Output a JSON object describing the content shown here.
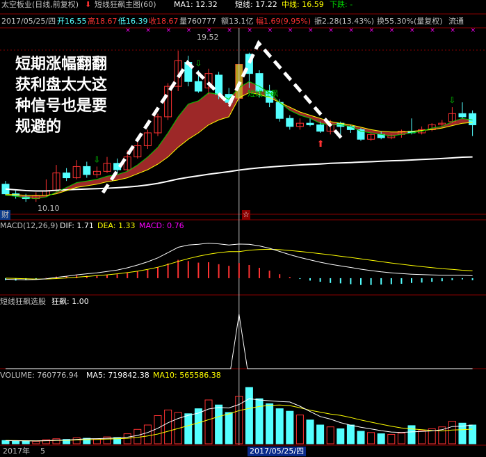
{
  "header": {
    "stock": "太空板业(日线,前复权)",
    "indicator": "短线狂飙主图(60)",
    "ma1": "MA1: 12.32",
    "short": "短线: 17.22",
    "mid": "中线: 16.59",
    "down": "下跌: -",
    "date": "2017/05/25/四",
    "open": "开16.55",
    "high": "高18.67",
    "low": "低16.39",
    "close": "收18.67",
    "volume": "量760777",
    "amount": "额13.1亿",
    "change": "幅1.69(9.95%)",
    "amplitude": "振2.28(13.43%)",
    "turnover": "换55.30%(量复权)",
    "float": "流通",
    "cursor_marker": "☆",
    "left_tag": "财"
  },
  "annotations": {
    "high_label": "19.52",
    "low_label": "10.10",
    "series_label": "短线狂飙",
    "note_lines": [
      "短期涨幅翻翻",
      "获利盘太大这",
      "种信号也是要",
      "规避的"
    ]
  },
  "macd_panel": {
    "title": "MACD(12,26,9)",
    "dif": "DIF: 1.71",
    "dea": "DEA: 1.33",
    "macd": "MACD: 0.76"
  },
  "signal_panel": {
    "title": "短线狂飙选股",
    "value": "狂飙: 1.00"
  },
  "volume_panel": {
    "title": "VOLUME: 760776.94",
    "ma5": "MA5: 719842.38",
    "ma10": "MA10: 565586.38"
  },
  "footer": {
    "year": "2017年",
    "month": "5",
    "date_box": "2017/05/25/四"
  },
  "colors": {
    "up": "#ff3232",
    "down": "#54ffff",
    "ma_white": "#ffffff",
    "ma_yellow": "#ffff00",
    "green_line": "#00cc00",
    "fill_red": "#a52a2a",
    "magenta": "#ff00ff"
  },
  "chart_data": {
    "type": "candlestick",
    "candles": [
      {
        "o": 11.2,
        "c": 10.6,
        "h": 11.4,
        "l": 10.5
      },
      {
        "o": 10.6,
        "c": 10.5,
        "h": 10.8,
        "l": 10.3
      },
      {
        "o": 10.4,
        "c": 10.3,
        "h": 10.6,
        "l": 10.1
      },
      {
        "o": 10.3,
        "c": 10.5,
        "h": 10.7,
        "l": 10.1
      },
      {
        "o": 10.5,
        "c": 10.8,
        "h": 11.5,
        "l": 10.4
      },
      {
        "o": 10.8,
        "c": 11.9,
        "h": 12.4,
        "l": 10.7
      },
      {
        "o": 11.9,
        "c": 11.6,
        "h": 12.2,
        "l": 11.4
      },
      {
        "o": 11.6,
        "c": 12.3,
        "h": 12.7,
        "l": 11.5
      },
      {
        "o": 12.3,
        "c": 11.8,
        "h": 12.6,
        "l": 11.6
      },
      {
        "o": 11.8,
        "c": 12.0,
        "h": 12.3,
        "l": 11.6
      },
      {
        "o": 12.0,
        "c": 12.5,
        "h": 12.9,
        "l": 11.9
      },
      {
        "o": 12.5,
        "c": 12.1,
        "h": 12.8,
        "l": 11.9
      },
      {
        "o": 12.1,
        "c": 12.9,
        "h": 13.3,
        "l": 12.0
      },
      {
        "o": 12.9,
        "c": 13.6,
        "h": 14.0,
        "l": 12.8
      },
      {
        "o": 13.6,
        "c": 14.4,
        "h": 14.6,
        "l": 13.4
      },
      {
        "o": 14.4,
        "c": 15.4,
        "h": 15.6,
        "l": 14.2
      },
      {
        "o": 15.4,
        "c": 17.3,
        "h": 17.5,
        "l": 15.2
      },
      {
        "o": 17.3,
        "c": 18.9,
        "h": 19.52,
        "l": 17.0
      },
      {
        "o": 18.8,
        "c": 17.6,
        "h": 19.2,
        "l": 17.3
      },
      {
        "o": 17.6,
        "c": 17.0,
        "h": 18.3,
        "l": 16.9
      },
      {
        "o": 17.2,
        "c": 18.1,
        "h": 18.4,
        "l": 16.8
      },
      {
        "o": 18.0,
        "c": 16.8,
        "h": 18.2,
        "l": 16.5
      },
      {
        "o": 16.8,
        "c": 16.3,
        "h": 17.2,
        "l": 16.1
      },
      {
        "o": 16.55,
        "c": 18.67,
        "h": 18.67,
        "l": 16.39
      },
      {
        "o": 19.3,
        "c": 18.1,
        "h": 19.4,
        "l": 17.2
      },
      {
        "o": 18.1,
        "c": 17.0,
        "h": 18.3,
        "l": 16.6
      },
      {
        "o": 17.0,
        "c": 16.3,
        "h": 17.4,
        "l": 16.0
      },
      {
        "o": 16.3,
        "c": 15.3,
        "h": 16.5,
        "l": 15.1
      },
      {
        "o": 15.3,
        "c": 14.8,
        "h": 15.5,
        "l": 14.6
      },
      {
        "o": 14.8,
        "c": 15.0,
        "h": 15.3,
        "l": 14.6
      },
      {
        "o": 15.0,
        "c": 14.9,
        "h": 15.3,
        "l": 14.8
      },
      {
        "o": 14.9,
        "c": 14.5,
        "h": 15.1,
        "l": 14.4
      },
      {
        "o": 14.5,
        "c": 14.9,
        "h": 15.2,
        "l": 14.3
      },
      {
        "o": 15.0,
        "c": 14.8,
        "h": 15.1,
        "l": 14.3
      },
      {
        "o": 14.8,
        "c": 14.6,
        "h": 14.9,
        "l": 14.4
      },
      {
        "o": 14.6,
        "c": 14.0,
        "h": 14.7,
        "l": 13.9
      },
      {
        "o": 14.0,
        "c": 14.3,
        "h": 14.4,
        "l": 13.9
      },
      {
        "o": 14.3,
        "c": 14.1,
        "h": 14.5,
        "l": 14.0
      },
      {
        "o": 14.1,
        "c": 14.2,
        "h": 14.3,
        "l": 14.0
      },
      {
        "o": 14.3,
        "c": 14.5,
        "h": 14.6,
        "l": 14.1
      },
      {
        "o": 14.5,
        "c": 14.4,
        "h": 15.3,
        "l": 14.3
      },
      {
        "o": 14.4,
        "c": 14.6,
        "h": 14.8,
        "l": 14.3
      },
      {
        "o": 14.6,
        "c": 14.9,
        "h": 15.0,
        "l": 14.5
      },
      {
        "o": 14.9,
        "c": 15.0,
        "h": 15.2,
        "l": 14.7
      },
      {
        "o": 15.1,
        "c": 15.6,
        "h": 16.0,
        "l": 15.0
      },
      {
        "o": 15.6,
        "c": 15.4,
        "h": 16.3,
        "l": 15.3
      },
      {
        "o": 15.6,
        "c": 14.9,
        "h": 15.8,
        "l": 14.2
      }
    ],
    "ma_long": [
      10.9,
      10.85,
      10.8,
      10.78,
      10.78,
      10.82,
      10.85,
      10.88,
      10.9,
      10.92,
      10.95,
      10.98,
      11.02,
      11.08,
      11.15,
      11.25,
      11.38,
      11.52,
      11.63,
      11.72,
      11.82,
      11.9,
      11.98,
      12.08,
      12.16,
      12.22,
      12.27,
      12.32,
      12.36,
      12.4,
      12.43,
      12.46,
      12.5,
      12.52,
      12.55,
      12.58,
      12.6,
      12.63,
      12.66,
      12.68,
      12.71,
      12.74,
      12.77,
      12.8,
      12.84,
      12.88,
      12.9
    ],
    "short_line": [
      10.5,
      10.45,
      10.35,
      10.3,
      10.4,
      10.7,
      11.0,
      11.3,
      11.4,
      11.5,
      11.7,
      11.8,
      12.0,
      12.4,
      12.9,
      13.5,
      14.4,
      15.4,
      16.2,
      16.4,
      16.9,
      16.8,
      16.5,
      17.22,
      17.6,
      17.3,
      16.9,
      16.3,
      15.8,
      15.5,
      15.3,
      15.0,
      14.9,
      14.9,
      14.8,
      14.5,
      14.4,
      14.3,
      14.2,
      14.3,
      14.4,
      14.5,
      14.7,
      14.8,
      15.1,
      15.3,
      15.2
    ],
    "mid_line": [
      10.55,
      10.55,
      10.5,
      10.48,
      10.5,
      10.6,
      10.8,
      11.0,
      11.1,
      11.2,
      11.35,
      11.45,
      11.6,
      11.85,
      12.1,
      12.45,
      12.9,
      13.5,
      14.0,
      14.4,
      14.9,
      15.2,
      15.4,
      16.59,
      16.9,
      16.8,
      16.6,
      16.3,
      16.0,
      15.7,
      15.5,
      15.3,
      15.1,
      15.0,
      14.9,
      14.75,
      14.6,
      14.5,
      14.45,
      14.45,
      14.5,
      14.55,
      14.6,
      14.7,
      14.85,
      15.0,
      15.05
    ],
    "price_range": [
      9.5,
      20.6
    ],
    "macd": {
      "hist": [
        -0.1,
        -0.12,
        -0.1,
        -0.05,
        0.02,
        0.08,
        0.1,
        0.14,
        0.12,
        0.14,
        0.18,
        0.2,
        0.26,
        0.34,
        0.42,
        0.56,
        0.74,
        0.92,
        0.86,
        0.78,
        0.8,
        0.7,
        0.62,
        0.76,
        0.66,
        0.52,
        0.38,
        0.2,
        0.06,
        -0.04,
        -0.12,
        -0.18,
        -0.24,
        -0.26,
        -0.3,
        -0.34,
        -0.34,
        -0.32,
        -0.3,
        -0.28,
        -0.24,
        -0.22,
        -0.18,
        -0.15,
        -0.1,
        -0.06,
        -0.1
      ],
      "dif": [
        -0.05,
        -0.07,
        -0.08,
        -0.07,
        -0.03,
        0.04,
        0.1,
        0.17,
        0.22,
        0.27,
        0.34,
        0.41,
        0.52,
        0.66,
        0.82,
        1.02,
        1.28,
        1.55,
        1.66,
        1.7,
        1.76,
        1.72,
        1.66,
        1.71,
        1.7,
        1.62,
        1.5,
        1.34,
        1.18,
        1.04,
        0.92,
        0.8,
        0.7,
        0.62,
        0.54,
        0.45,
        0.38,
        0.32,
        0.27,
        0.23,
        0.2,
        0.18,
        0.16,
        0.15,
        0.15,
        0.15,
        0.12
      ],
      "dea": [
        0.0,
        -0.01,
        -0.03,
        -0.04,
        -0.04,
        -0.02,
        0.01,
        0.05,
        0.09,
        0.13,
        0.17,
        0.22,
        0.28,
        0.35,
        0.44,
        0.55,
        0.69,
        0.84,
        0.98,
        1.1,
        1.2,
        1.28,
        1.33,
        1.33,
        1.4,
        1.44,
        1.45,
        1.43,
        1.39,
        1.34,
        1.29,
        1.23,
        1.17,
        1.1,
        1.04,
        0.97,
        0.9,
        0.83,
        0.76,
        0.7,
        0.64,
        0.58,
        0.53,
        0.48,
        0.44,
        0.4,
        0.37
      ],
      "range": [
        -0.7,
        2.3
      ]
    },
    "signal": {
      "values": [
        0,
        0,
        0,
        0,
        0,
        0,
        0,
        0,
        0,
        0,
        0,
        0,
        0,
        0,
        0,
        0,
        0,
        0,
        0,
        0,
        0,
        0,
        0,
        1,
        0,
        0,
        0,
        0,
        0,
        0,
        0,
        0,
        0,
        0,
        0,
        0,
        0,
        0,
        0,
        0,
        0,
        0,
        0,
        0,
        0,
        0,
        0
      ],
      "range": [
        0,
        1.1
      ]
    },
    "volume": {
      "values": [
        52000,
        48000,
        45000,
        40000,
        65000,
        80000,
        70000,
        95000,
        88000,
        75000,
        110000,
        100000,
        160000,
        230000,
        300000,
        450000,
        540000,
        500000,
        480000,
        560000,
        700000,
        620000,
        500000,
        760777,
        900000,
        720000,
        640000,
        560000,
        520000,
        460000,
        380000,
        300000,
        270000,
        240000,
        300000,
        200000,
        180000,
        160000,
        150000,
        170000,
        290000,
        210000,
        240000,
        270000,
        360000,
        330000,
        300000
      ],
      "ma5": [
        50000,
        49000,
        47000,
        46000,
        50000,
        56000,
        60000,
        70000,
        80000,
        82000,
        88000,
        94000,
        105000,
        133000,
        180000,
        248000,
        336000,
        404000,
        454000,
        490000,
        556000,
        580000,
        572000,
        628000,
        719842,
        700000,
        688000,
        676000,
        668000,
        600000,
        516000,
        436000,
        394000,
        338000,
        298000,
        264000,
        238000,
        210000,
        188000,
        180000,
        190000,
        198000,
        206000,
        224000,
        276000,
        282000,
        300000
      ],
      "ma10": [
        52000,
        51000,
        49000,
        47000,
        49000,
        53000,
        56000,
        61000,
        66000,
        69000,
        75000,
        80000,
        88000,
        102000,
        124000,
        156000,
        200000,
        244000,
        290000,
        335000,
        385000,
        436000,
        478000,
        530000,
        565586,
        596000,
        614000,
        620000,
        610000,
        574000,
        536000,
        506000,
        476000,
        454000,
        420000,
        380000,
        346000,
        312000,
        280000,
        252000,
        238000,
        224000,
        212000,
        206000,
        220000,
        224000,
        234000
      ],
      "range": [
        0,
        1000000
      ]
    },
    "cursor_index": 23
  }
}
